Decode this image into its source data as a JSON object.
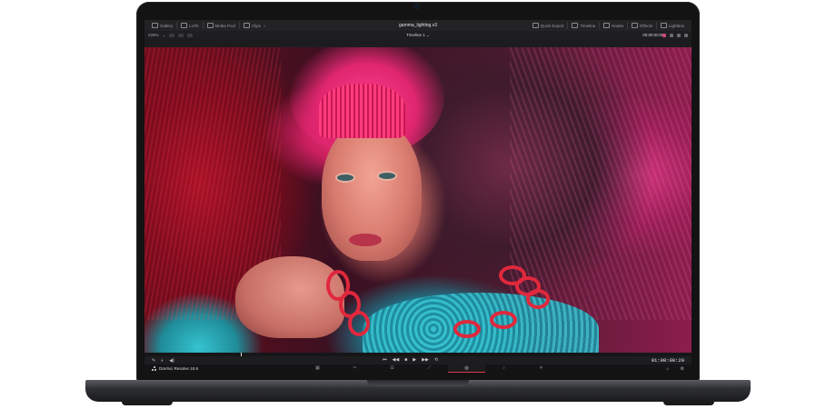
{
  "app": {
    "project_title": "gamma_lighting.v3",
    "brand_name": "DaVinci Resolve 18.6"
  },
  "toolbar": {
    "left": [
      {
        "label": "Gallery",
        "icon": "gallery-icon"
      },
      {
        "label": "LUTs",
        "icon": "luts-icon"
      },
      {
        "label": "Media Pool",
        "icon": "media-pool-icon"
      },
      {
        "label": "Clips",
        "icon": "clips-icon"
      }
    ],
    "right": [
      {
        "label": "Quick Export",
        "icon": "export-icon"
      },
      {
        "label": "Timeline",
        "icon": "timeline-icon"
      },
      {
        "label": "Nodes",
        "icon": "nodes-icon"
      },
      {
        "label": "Effects",
        "icon": "effects-icon"
      },
      {
        "label": "Lightbox",
        "icon": "lightbox-icon"
      }
    ]
  },
  "viewer": {
    "zoom": "220%",
    "timeline_name": "Timeline 1",
    "source_timecode": "00:00:00:00"
  },
  "transport": {
    "buttons": [
      "⏮",
      "◀◀",
      "■",
      "▶",
      "▶▶",
      "⟲"
    ],
    "timecode": "01:00:00:20"
  },
  "pages": {
    "tabs": [
      "▦",
      "✂",
      "☰",
      "⟋",
      "◎",
      "♪",
      "✈"
    ],
    "active_index": 4,
    "right_icons": [
      "⌂",
      "⚙"
    ]
  },
  "colors": {
    "accent": "#e0384e",
    "toolbar_bg": "#232326",
    "viewer_pink": "#e0266f",
    "viewer_teal": "#39c3d0"
  }
}
